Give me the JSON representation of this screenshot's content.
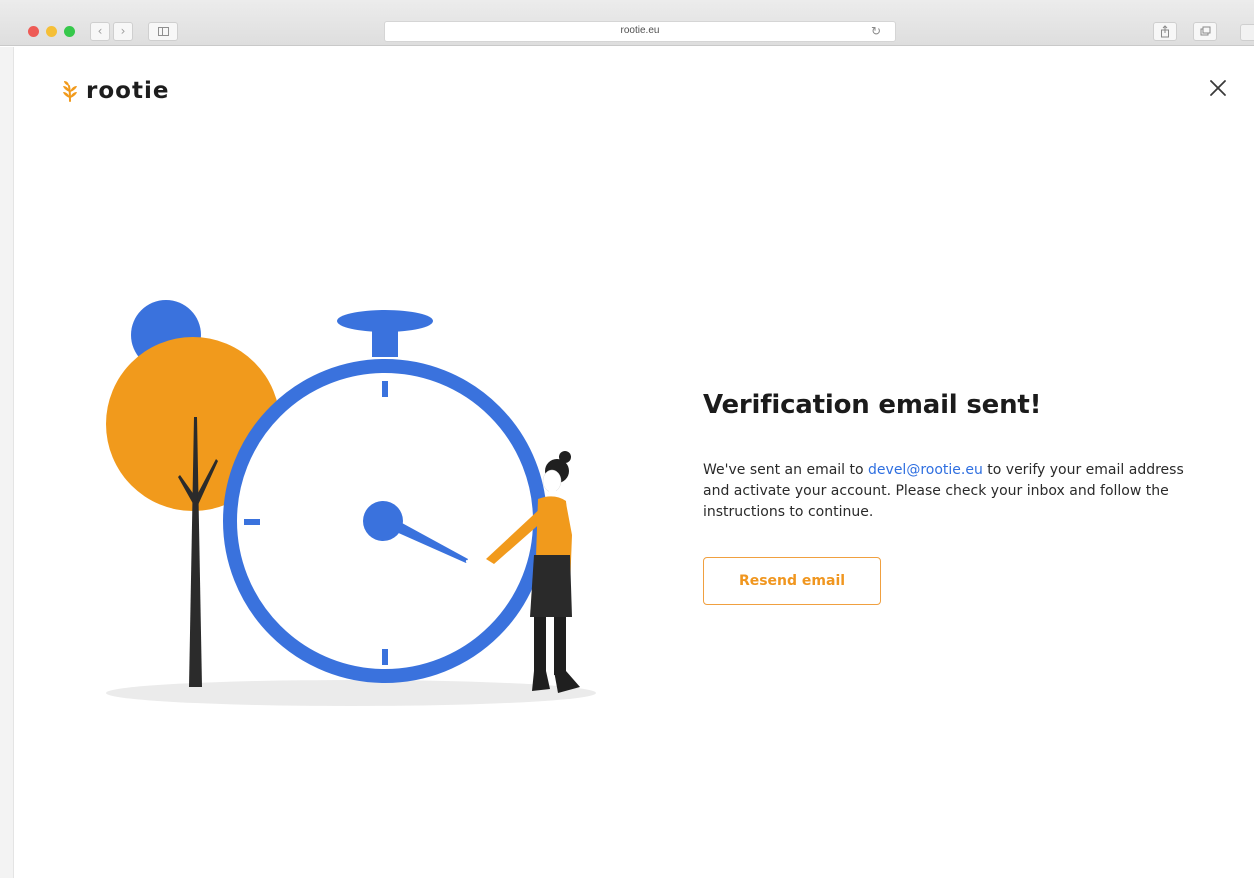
{
  "browser": {
    "url": "rootie.eu"
  },
  "brand": {
    "name": "rootie",
    "accent_color": "#f0961f",
    "link_color": "#2f6fe0",
    "illustration_blue": "#3a72dd",
    "illustration_orange": "#f19a1c"
  },
  "verification": {
    "title": "Verification email sent!",
    "message_before": "We've sent an email to ",
    "email": "devel@rootie.eu",
    "message_after": " to verify your email address and activate your account. Please check your inbox and follow the instructions to continue.",
    "resend_label": "Resend email"
  },
  "icons": {
    "close": "close-icon",
    "logo": "wheat-leaf-icon",
    "reload": "reload-icon",
    "share": "share-icon",
    "tabs": "tabs-icon"
  }
}
